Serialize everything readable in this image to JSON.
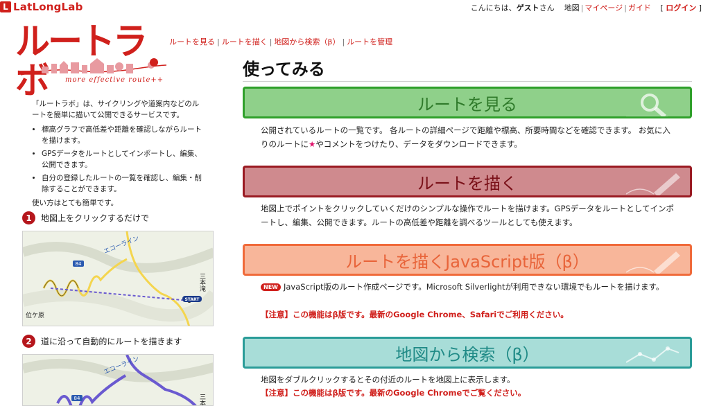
{
  "header": {
    "logo_mark": "L",
    "logo_text": "LatLongLab",
    "greeting_prefix": "こんにちは、",
    "guest_name": "ゲスト",
    "greeting_suffix": "さん",
    "links": [
      "地図",
      "マイページ",
      "ガイド"
    ],
    "login_open": "[",
    "login_label": "ログイン",
    "login_close": "]"
  },
  "brand": {
    "title": "ルートラボ",
    "tagline": "more effective route++"
  },
  "subnav": [
    "ルートを見る",
    "ルートを描く",
    "地図から検索（β）",
    "ルートを管理"
  ],
  "sidebar": {
    "intro": "「ルートラボ」は、サイクリングや道案内などのルートを簡単に描いて公開できるサービスです。",
    "bullets": [
      "標高グラフで高低差や距離を確認しながらルートを描けます。",
      "GPSデータをルートとしてインポートし、編集、公開できます。",
      "自分の登録したルートの一覧を確認し、編集・削除することができます。"
    ],
    "outro": "使い方はとても簡単です。",
    "steps": [
      {
        "num": "1",
        "label": "地図上をクリックするだけで"
      },
      {
        "num": "2",
        "label": "道に沿って自動的にルートを描きます"
      }
    ],
    "map1": {
      "road": "エコーライン",
      "route_no": "84",
      "place_a": "三本滝",
      "place_b": "位ケ原",
      "start": "START"
    },
    "map2": {
      "road": "エコーライン",
      "route_no": "84",
      "place_a": "三本"
    }
  },
  "main": {
    "title": "使ってみる",
    "sections": [
      {
        "label": "ルートを見る",
        "icon": "magnifier-icon",
        "colors": {
          "bg": "#8fd08a",
          "border": "#2fa02a",
          "text": "#2f7a2a"
        },
        "desc_a": "公開されているルートの一覧です。 各ルートの詳細ページで距離や標高、所要時間などを確認できます。 お気に入りのルートに",
        "star": "★",
        "desc_b": "やコメントをつけたり、データをダウンロードできます。"
      },
      {
        "label": "ルートを描く",
        "icon": "pen-icon",
        "colors": {
          "bg": "#cf8a8e",
          "border": "#9a1a22",
          "text": "#7a1018"
        },
        "desc": "地図上でポイントをクリックしていくだけのシンプルな操作でルートを描けます。GPSデータをルートとしてインポートし、編集、公開できます。ルートの高低差や距離を調べるツールとしても使えます。"
      },
      {
        "label": "ルートを描くJavaScript版（β）",
        "icon": "pen-icon",
        "colors": {
          "bg": "#f8b69a",
          "border": "#f06a3a",
          "text": "#e8643a"
        },
        "badge": "NEW",
        "desc": "JavaScript版のルート作成ページです。Microsoft Silverlightが利用できない環境でもルートを描けます。",
        "warning": "【注意】この機能はβ版です。最新のGoogle Chrome、Safariでご利用ください。"
      },
      {
        "label": "地図から検索（β）",
        "icon": "route-map-icon",
        "colors": {
          "bg": "#a8ddd8",
          "border": "#2a9c98",
          "text": "#1f8a86"
        },
        "desc": "地図をダブルクリックするとその付近のルートを地図上に表示します。",
        "warning": "【注意】この機能はβ版です。最新のGoogle Chromeでご覧ください。"
      }
    ]
  }
}
